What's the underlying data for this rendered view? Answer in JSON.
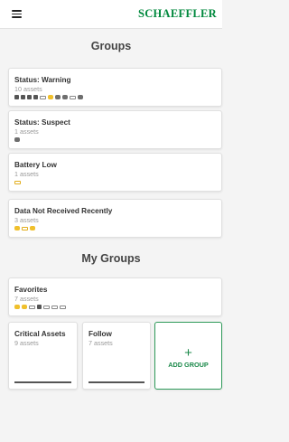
{
  "header": {
    "brand": "SCHAEFFLER"
  },
  "groups_title": "Groups",
  "groups": [
    {
      "title": "Status: Warning",
      "count": "10 assets",
      "icons": [
        "sq",
        "sq",
        "sq",
        "sq",
        "bat",
        "y",
        "gw",
        "gw",
        "bat",
        "gw"
      ]
    },
    {
      "title": "Status: Suspect",
      "count": "1 assets",
      "icons": [
        "gw"
      ]
    },
    {
      "title": "Battery Low",
      "count": "1 assets",
      "icons": [
        "baty"
      ]
    },
    {
      "title": "Data Not Received Recently",
      "count": "3 assets",
      "icons": [
        "y",
        "baty",
        "y"
      ]
    }
  ],
  "my_groups_title": "My Groups",
  "my_groups": [
    {
      "title": "Favorites",
      "count": "7 assets",
      "icons": [
        "y",
        "y",
        "bat",
        "sq",
        "bat",
        "bat",
        "bat"
      ]
    },
    {
      "title": "Critical Assets",
      "count": "9 assets"
    },
    {
      "title": "Follow",
      "count": "7 assets"
    }
  ],
  "add_group": {
    "plus": "+",
    "label": "ADD GROUP"
  },
  "colors": {
    "brand": "#00893d",
    "warning_yellow": "#f0c02c",
    "gateway_gray": "#6e6e6e"
  }
}
